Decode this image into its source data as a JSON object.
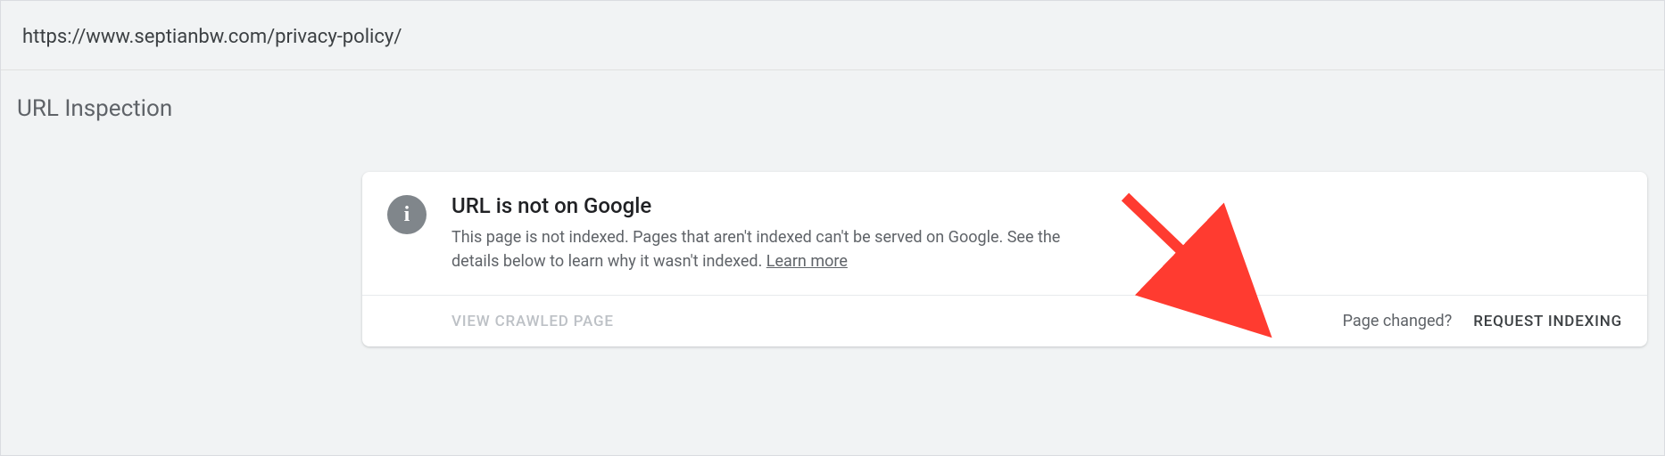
{
  "url_bar": {
    "url": "https://www.septianbw.com/privacy-policy/"
  },
  "section": {
    "title": "URL Inspection"
  },
  "card": {
    "title": "URL is not on Google",
    "description": "This page is not indexed. Pages that aren't indexed can't be served on Google. See the details below to learn why it wasn't indexed. ",
    "learn_more": "Learn more",
    "footer": {
      "view_crawled": "VIEW CRAWLED PAGE",
      "page_changed": "Page changed?",
      "request_indexing": "REQUEST INDEXING"
    }
  }
}
